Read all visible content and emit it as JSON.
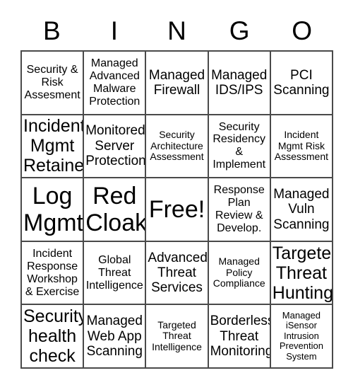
{
  "card": {
    "title_letters": [
      "B",
      "I",
      "N",
      "G",
      "O"
    ],
    "free_space_label": "Free!",
    "colors": {
      "background": "#ffffff",
      "text": "#000000",
      "grid_line": "#4a4a4a"
    },
    "grid": {
      "columns": 5,
      "rows": 5
    }
  },
  "cells": [
    {
      "row": 1,
      "col": 1,
      "text": "Security &\nRisk\nAssesment",
      "size": "fs-sm"
    },
    {
      "row": 1,
      "col": 2,
      "text": "Managed\nAdvanced\nMalware\nProtection",
      "size": "fs-sm"
    },
    {
      "row": 1,
      "col": 3,
      "text": "Managed\nFirewall",
      "size": "fs-md"
    },
    {
      "row": 1,
      "col": 4,
      "text": "Managed\nIDS/IPS",
      "size": "fs-md"
    },
    {
      "row": 1,
      "col": 5,
      "text": "PCI\nScanning",
      "size": "fs-md"
    },
    {
      "row": 2,
      "col": 1,
      "text": "Incident\nMgmt\nRetainer",
      "size": "fs-lg"
    },
    {
      "row": 2,
      "col": 2,
      "text": "Monitored\nServer\nProtection",
      "size": "fs-md"
    },
    {
      "row": 2,
      "col": 3,
      "text": "Security\nArchitecture\nAssessment",
      "size": "fs-xs"
    },
    {
      "row": 2,
      "col": 4,
      "text": "Security\nResidency\n&\nImplement",
      "size": "fs-sm"
    },
    {
      "row": 2,
      "col": 5,
      "text": "Incident\nMgmt Risk\nAssessment",
      "size": "fs-xs"
    },
    {
      "row": 3,
      "col": 1,
      "text": "Log\nMgmt",
      "size": "fs-xl"
    },
    {
      "row": 3,
      "col": 2,
      "text": "Red\nCloak",
      "size": "fs-xl"
    },
    {
      "row": 3,
      "col": 3,
      "text": "Free!",
      "size": "fs-xl"
    },
    {
      "row": 3,
      "col": 4,
      "text": "Response\nPlan\nReview &\nDevelop.",
      "size": "fs-sm"
    },
    {
      "row": 3,
      "col": 5,
      "text": "Managed\nVuln\nScanning",
      "size": "fs-md"
    },
    {
      "row": 4,
      "col": 1,
      "text": "Incident\nResponse\nWorkshop\n& Exercise",
      "size": "fs-sm"
    },
    {
      "row": 4,
      "col": 2,
      "text": "Global\nThreat\nIntelligence",
      "size": "fs-sm"
    },
    {
      "row": 4,
      "col": 3,
      "text": "Advanced\nThreat\nServices",
      "size": "fs-md"
    },
    {
      "row": 4,
      "col": 4,
      "text": "Managed\nPolicy\nCompliance",
      "size": "fs-xs"
    },
    {
      "row": 4,
      "col": 5,
      "text": "Targeted\nThreat\nHunting",
      "size": "fs-lg"
    },
    {
      "row": 5,
      "col": 1,
      "text": "Security\nhealth\ncheck",
      "size": "fs-lg"
    },
    {
      "row": 5,
      "col": 2,
      "text": "Managed\nWeb App\nScanning",
      "size": "fs-md"
    },
    {
      "row": 5,
      "col": 3,
      "text": "Targeted\nThreat\nIntelligence",
      "size": "fs-xs"
    },
    {
      "row": 5,
      "col": 4,
      "text": "Borderless\nThreat\nMonitoring",
      "size": "fs-md"
    },
    {
      "row": 5,
      "col": 5,
      "text": "Managed\niSensor\nIntrusion\nPrevention\nSystem",
      "size": "fs-xxs"
    }
  ]
}
